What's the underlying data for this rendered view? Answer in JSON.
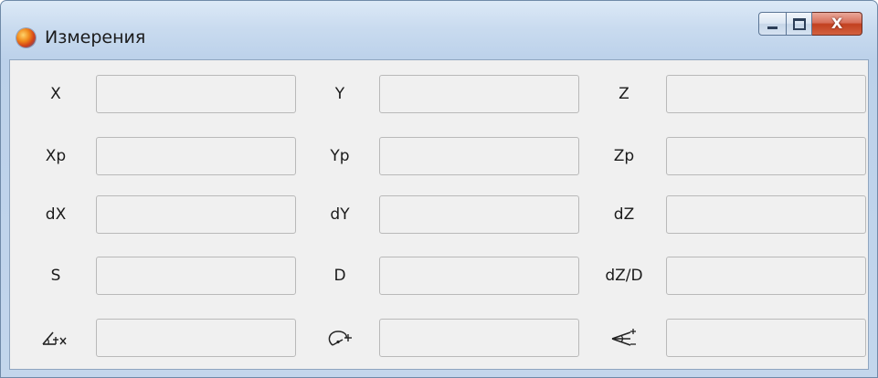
{
  "window": {
    "title": "Измерения",
    "icon": "globe-app-icon",
    "controls": {
      "minimize": "minimize-icon",
      "maximize": "maximize-icon",
      "close": "close-icon",
      "close_glyph": "X"
    }
  },
  "fields": {
    "x": {
      "label": "X",
      "value": ""
    },
    "y": {
      "label": "Y",
      "value": ""
    },
    "z": {
      "label": "Z",
      "value": ""
    },
    "xp": {
      "label": "Xp",
      "value": ""
    },
    "yp": {
      "label": "Yp",
      "value": ""
    },
    "zp": {
      "label": "Zp",
      "value": ""
    },
    "dx": {
      "label": "dX",
      "value": ""
    },
    "dy": {
      "label": "dY",
      "value": ""
    },
    "dz": {
      "label": "dZ",
      "value": ""
    },
    "s": {
      "label": "S",
      "value": ""
    },
    "d": {
      "label": "D",
      "value": ""
    },
    "dzd": {
      "label": "dZ/D",
      "value": ""
    },
    "angle_x": {
      "icon": "angle-x-icon",
      "value": ""
    },
    "azimuth": {
      "icon": "azimuth-arc-icon",
      "value": ""
    },
    "slope": {
      "icon": "slope-angle-icon",
      "value": ""
    }
  },
  "colors": {
    "title_gradient_top": "#dce9f7",
    "client_bg": "#f0f0f0",
    "close_button": "#c2401f",
    "input_border": "#b9b9b9"
  }
}
